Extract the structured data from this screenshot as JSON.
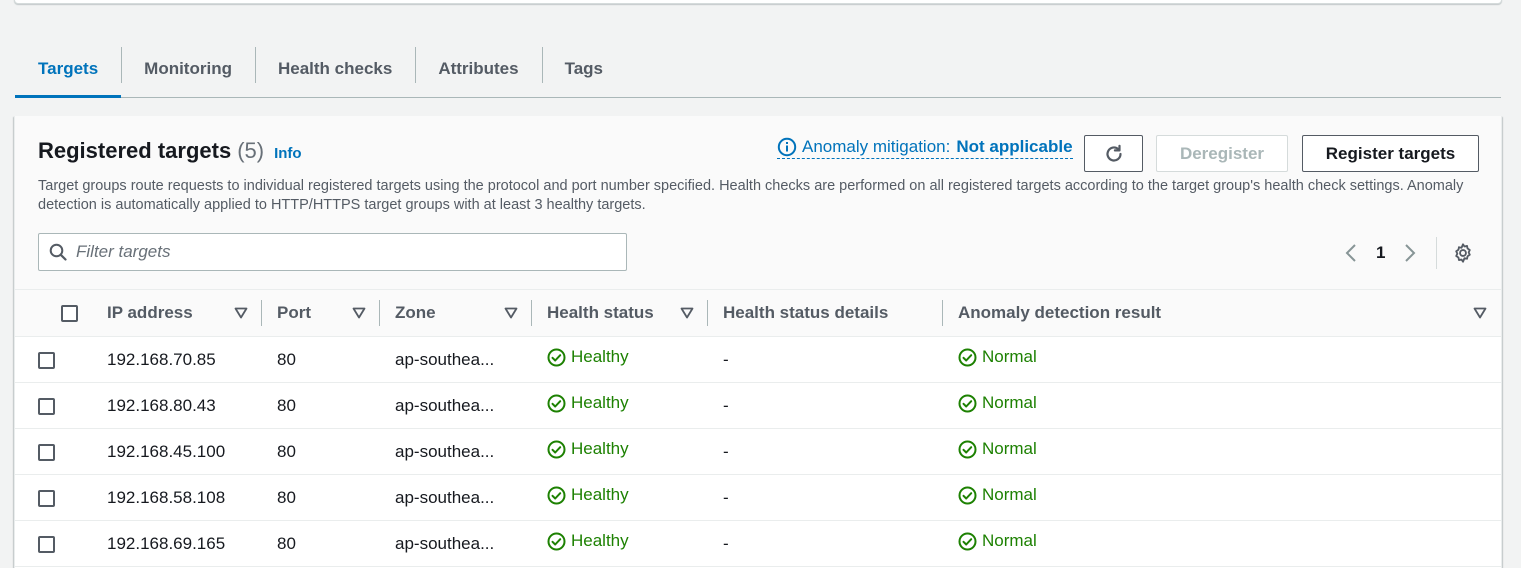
{
  "tabs": [
    {
      "label": "Targets",
      "active": true
    },
    {
      "label": "Monitoring",
      "active": false
    },
    {
      "label": "Health checks",
      "active": false
    },
    {
      "label": "Attributes",
      "active": false
    },
    {
      "label": "Tags",
      "active": false
    }
  ],
  "header": {
    "title": "Registered targets",
    "count": "(5)",
    "info": "Info",
    "anomaly_label": "Anomaly mitigation:",
    "anomaly_value": "Not applicable",
    "deregister_label": "Deregister",
    "register_label": "Register targets",
    "description": "Target groups route requests to individual registered targets using the protocol and port number specified. Health checks are performed on all registered targets according to the target group's health check settings. Anomaly detection is automatically applied to HTTP/HTTPS target groups with at least 3 healthy targets."
  },
  "filter": {
    "placeholder": "Filter targets",
    "value": ""
  },
  "pagination": {
    "current_page": "1"
  },
  "table": {
    "columns": [
      "IP address",
      "Port",
      "Zone",
      "Health status",
      "Health status details",
      "Anomaly detection result"
    ],
    "rows": [
      {
        "ip": "192.168.70.85",
        "port": "80",
        "zone": "ap-southea...",
        "health": "Healthy",
        "details": "-",
        "anomaly": "Normal"
      },
      {
        "ip": "192.168.80.43",
        "port": "80",
        "zone": "ap-southea...",
        "health": "Healthy",
        "details": "-",
        "anomaly": "Normal"
      },
      {
        "ip": "192.168.45.100",
        "port": "80",
        "zone": "ap-southea...",
        "health": "Healthy",
        "details": "-",
        "anomaly": "Normal"
      },
      {
        "ip": "192.168.58.108",
        "port": "80",
        "zone": "ap-southea...",
        "health": "Healthy",
        "details": "-",
        "anomaly": "Normal"
      },
      {
        "ip": "192.168.69.165",
        "port": "80",
        "zone": "ap-southea...",
        "health": "Healthy",
        "details": "-",
        "anomaly": "Normal"
      }
    ]
  },
  "icons": {
    "info": "info-circle-icon",
    "refresh": "refresh-icon",
    "search": "search-icon",
    "prev": "chevron-left-icon",
    "next": "chevron-right-icon",
    "settings": "gear-icon",
    "sort": "caret-down-icon",
    "status_ok": "check-circle-icon"
  },
  "colors": {
    "accent": "#0073bb",
    "success": "#1d8102",
    "text": "#16191f",
    "muted": "#545b64"
  }
}
